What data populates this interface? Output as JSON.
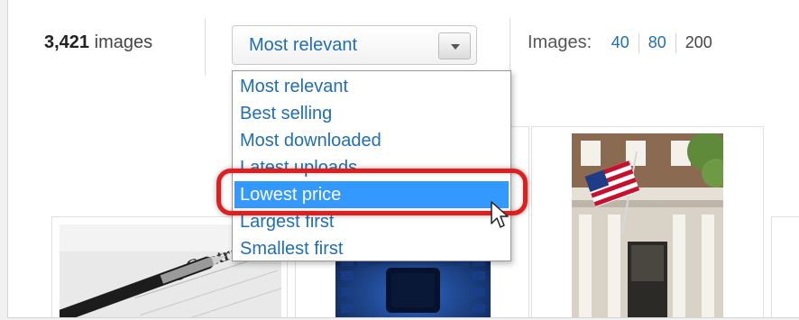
{
  "results": {
    "count": "3,421",
    "unit": "images"
  },
  "sort": {
    "selected": "Most relevant",
    "options": [
      "Most relevant",
      "Best selling",
      "Most downloaded",
      "Latest uploads",
      "Lowest price",
      "Largest first",
      "Smallest first"
    ],
    "highlighted": "Lowest price"
  },
  "per_page": {
    "label": "Images:",
    "options": [
      "40",
      "80",
      "200"
    ],
    "current": "200"
  },
  "thumbnails": [
    {
      "name": "contract-thumbnail",
      "visible_text": "g Contract"
    },
    {
      "name": "keyboard-thumbnail"
    },
    {
      "name": "building-flag-thumbnail"
    }
  ],
  "colors": {
    "link": "#1f6fb2",
    "highlight": "#3399ff",
    "callout": "#e11d1d"
  }
}
